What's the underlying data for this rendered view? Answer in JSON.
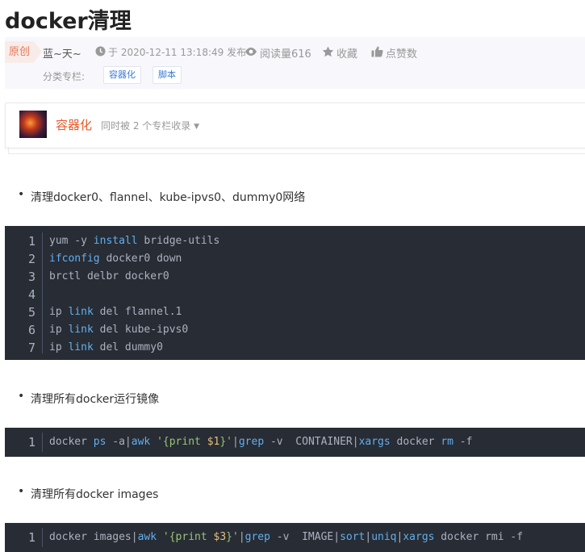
{
  "article": {
    "title": "docker清理",
    "badge": "原创",
    "author": "蓝~天~",
    "date": "于 2020-12-11 13:18:49 发布",
    "reads": "阅读量616",
    "favorite": "收藏",
    "like": "点赞数",
    "category_label": "分类专栏:",
    "tags": [
      "容器化",
      "脚本"
    ]
  },
  "column": {
    "name": "容器化",
    "note": "同时被 2 个专栏收录"
  },
  "sections": [
    {
      "bullet": "清理docker0、flannel、kube-ipvs0、dummy0网络",
      "lines": [
        {
          "n": "1",
          "code": "yum -y install bridge-utils"
        },
        {
          "n": "2",
          "code": "ifconfig docker0 down"
        },
        {
          "n": "3",
          "code": "brctl delbr docker0"
        },
        {
          "n": "4",
          "code": ""
        },
        {
          "n": "5",
          "code": "ip link del flannel.1"
        },
        {
          "n": "6",
          "code": "ip link del kube-ipvs0"
        },
        {
          "n": "7",
          "code": "ip link del dummy0"
        }
      ]
    },
    {
      "bullet": "清理所有docker运行镜像",
      "lines": [
        {
          "n": "1",
          "code": "docker ps -a|awk '{print $1}'|grep -v  CONTAINER|xargs docker rm -f"
        }
      ]
    },
    {
      "bullet": "清理所有docker images",
      "lines": [
        {
          "n": "1",
          "code": "docker images|awk '{print $3}'|grep -v  IMAGE|sort|uniq|xargs docker rmi -f"
        }
      ]
    }
  ],
  "icons": {
    "clock": "clock-icon",
    "eye": "eye-icon",
    "star": "star-icon",
    "thumb": "thumbs-up-icon",
    "caret": "caret-down-icon"
  },
  "colors": {
    "code_bg": "#282c34",
    "keyword": "#61afef",
    "string": "#98c379",
    "variable": "#e5c07b",
    "badge": "#e3795e",
    "column_name": "#e55a2b"
  }
}
